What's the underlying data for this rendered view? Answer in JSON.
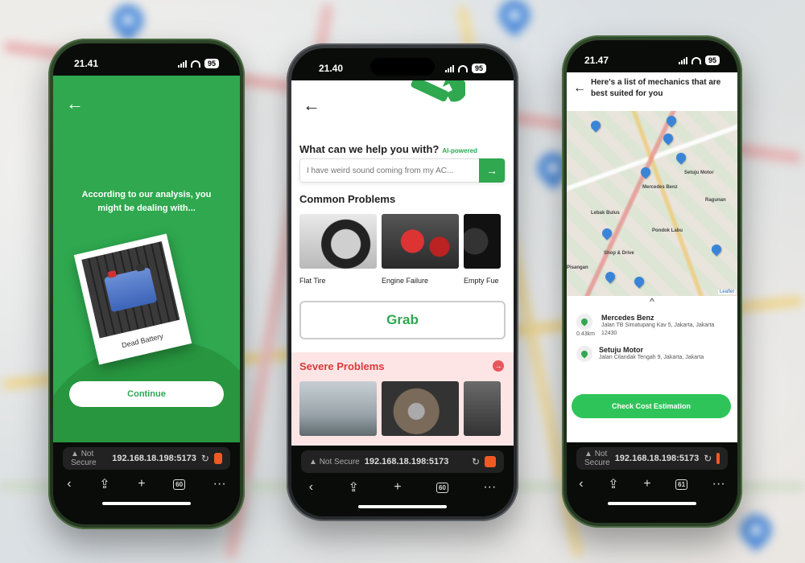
{
  "left_phone": {
    "time": "21.41",
    "battery": "95",
    "analysis_text": "According to our analysis, you might be dealing with...",
    "polaroid_caption": "Dead Battery",
    "continue_label": "Continue",
    "browser": {
      "not_secure": "Not Secure",
      "url": "192.168.18.198:5173",
      "tab_count": "60"
    }
  },
  "center_phone": {
    "time": "21.40",
    "battery": "95",
    "help_title": "What can we help you with?",
    "ai_badge": "AI-powered",
    "search_placeholder": "I have weird sound coming from my AC...",
    "common_title": "Common Problems",
    "common_problems": [
      {
        "label": "Flat Tire"
      },
      {
        "label": "Engine Failure"
      },
      {
        "label": "Empty Fue"
      }
    ],
    "partner_logo": "Grab",
    "severe_title": "Severe Problems",
    "browser": {
      "not_secure": "Not Secure",
      "url": "192.168.18.198:5173",
      "tab_count": "60"
    }
  },
  "right_phone": {
    "time": "21.47",
    "battery": "95",
    "title": "Here's a list of mechanics that are best suited for you",
    "map_labels": {
      "mercedes": "Mercedes Benz",
      "setuju": "Setuju Motor",
      "lebak": "Lebak Bulus",
      "pondok_labu": "Pondok Labu",
      "shop_drive": "Shop & Drive",
      "pisangan": "Pisangan",
      "ragunan": "Ragunan"
    },
    "attribution": "Leaflet",
    "mechanics": [
      {
        "name": "Mercedes Benz",
        "address": "Jalan TB Simatupang Kav 5, Jakarta, Jakarta 12430",
        "distance": "0.43km"
      },
      {
        "name": "Setuju Motor",
        "address": "Jalan Cilandak Tengah 9, Jakarta, Jakarta",
        "distance": ""
      }
    ],
    "cost_button": "Check Cost Estimation",
    "browser": {
      "not_secure": "Not Secure",
      "url": "192.168.18.198:5173",
      "tab_count": "61"
    }
  },
  "colors": {
    "brand_green": "#2fa84f",
    "severe_red": "#d93a3a",
    "pin_blue": "#3a84d8"
  }
}
